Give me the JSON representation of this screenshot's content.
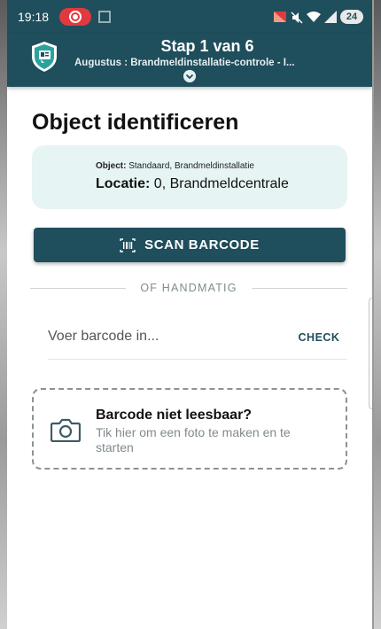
{
  "status_bar": {
    "time": "19:18",
    "battery": "24"
  },
  "header": {
    "title": "Stap 1 van 6",
    "subtitle": "Augustus : Brandmeldinstallatie-controle - I..."
  },
  "page": {
    "title": "Object identificeren"
  },
  "info": {
    "object_label": "Object:",
    "object_value": "Standaard, Brandmeldinstallatie",
    "locatie_label": "Locatie:",
    "locatie_value": "0, Brandmeldcentrale"
  },
  "scan": {
    "label": "SCAN BARCODE"
  },
  "divider": {
    "label": "OF HANDMATIG"
  },
  "barcode_field": {
    "placeholder": "Voer barcode in...",
    "check_label": "CHECK"
  },
  "photo": {
    "title": "Barcode niet leesbaar?",
    "subtitle": "Tik hier om een foto te maken en te starten"
  },
  "colors": {
    "primary": "#1f4e5c",
    "card_bg": "#e6f4f3",
    "record": "#e0393e"
  },
  "icons": [
    "record-icon",
    "expand-icon",
    "signal-icon",
    "wifi-icon",
    "mute-icon",
    "app-logo-icon",
    "chevron-down-icon",
    "barcode-icon",
    "camera-icon"
  ]
}
